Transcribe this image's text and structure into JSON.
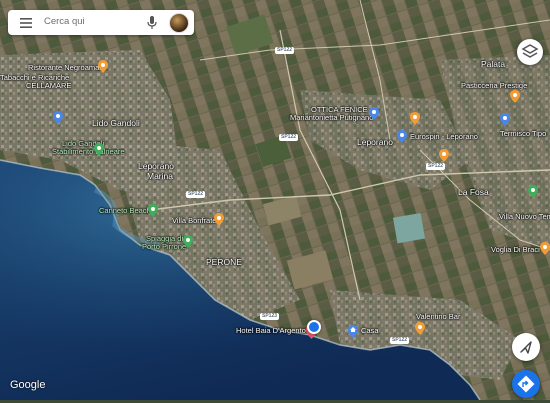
{
  "search": {
    "placeholder": "Cerca qui"
  },
  "attribution": "Google",
  "colors": {
    "water_deep": "#1a3a6a",
    "water_shallow": "#2e5c8a",
    "land": "#5a5a44",
    "pin_orange": "#f29c33",
    "pin_green": "#3fae5b",
    "pin_blue": "#4a86e8",
    "location": "#1a73e8"
  },
  "places": {
    "ristorante_negroamaro": "Ristorante Negroamaro",
    "tabacchi": "Tabacchi e Ricariche",
    "cellamare": "CELLAMARE",
    "lido_gandoli": "Lido Gandoli",
    "lido_gandoli_stab": "Lido Gandoli",
    "stabilimento": "Stabilimento balneare",
    "leporano_marina": "Leporano",
    "marina": "Marina",
    "canneto_beach": "Canneto Beach",
    "villa_bonfrate": "Villa Bonfrate",
    "spiaggia": "Spiaggia di",
    "porto_pirrone": "Porto Pirrone",
    "perone": "PERONE",
    "hotel": "Hotel Baia D'Argento",
    "casa": "Casa",
    "valentino": "Valentino Bar",
    "ottica": "OTTICA FENICE",
    "mariantonietta": "Mariantonietta Putignano",
    "leporano": "Leporano",
    "eurospin": "Eurospin - Leporano",
    "palata": "Palata",
    "pasticceria": "Pasticceria Prestige",
    "la_fosa": "La Fosa",
    "villa_nuovo": "Villa Nuovo Tem",
    "voglia": "Voglia Di Braci",
    "termisco": "Termisco Tipo"
  },
  "roads": {
    "sp122_a": "SP122",
    "sp122_b": "SP122",
    "sp122_c": "SP122",
    "sp122_d": "SP122",
    "sp123": "SP123",
    "sp122_e": "SP122"
  }
}
